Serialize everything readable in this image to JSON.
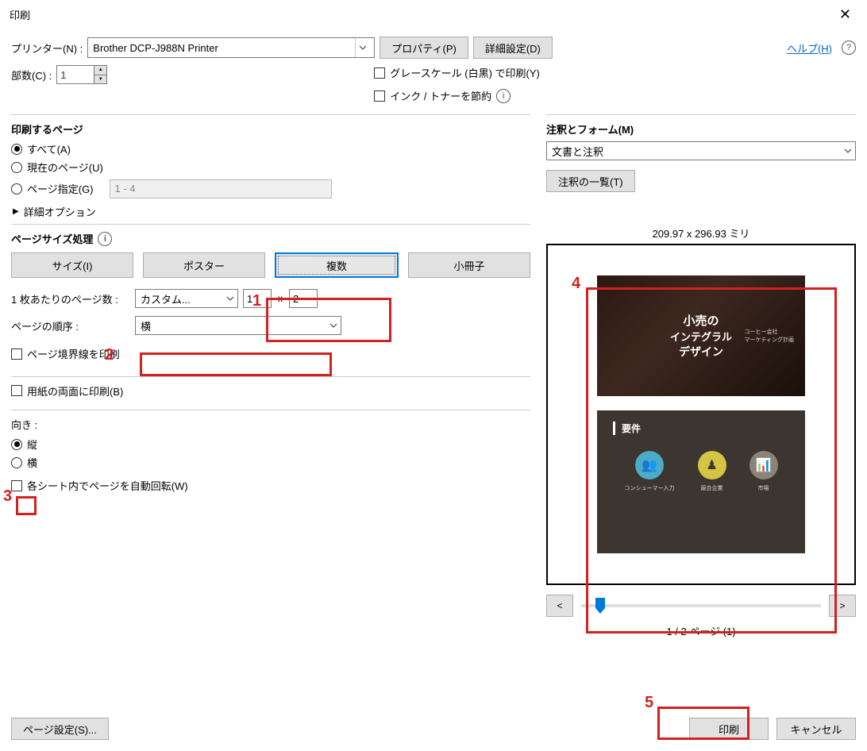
{
  "window": {
    "title": "印刷"
  },
  "help": {
    "text": "ヘルプ(H)"
  },
  "printer": {
    "label": "プリンター(N) :",
    "value": "Brother DCP-J988N Printer",
    "properties_button": "プロパティ(P)",
    "advanced_button": "詳細設定(D)"
  },
  "copies": {
    "label": "部数(C) :",
    "value": "1"
  },
  "options": {
    "grayscale": "グレースケール (白黒) で印刷(Y)",
    "save_ink": "インク / トナーを節約"
  },
  "pages": {
    "section": "印刷するページ",
    "all": "すべて(A)",
    "current": "現在のページ(U)",
    "range_label": "ページ指定(G)",
    "range_value": "1 - 4",
    "advanced": "詳細オプション"
  },
  "size": {
    "section": "ページサイズ処理",
    "tabs": {
      "size": "サイズ(I)",
      "poster": "ポスター",
      "multiple": "複数",
      "booklet": "小冊子"
    },
    "pages_per_sheet_label": "1 枚あたりのページ数 :",
    "pages_per_sheet_value": "カスタム...",
    "custom_w": "1",
    "custom_x": "x",
    "custom_h": "2",
    "order_label": "ページの順序 :",
    "order_value": "横",
    "border": "ページ境界線を印刷"
  },
  "duplex": {
    "label": "用紙の両面に印刷(B)"
  },
  "orientation": {
    "label": "向き :",
    "portrait": "縦",
    "landscape": "横",
    "auto_rotate": "各シート内でページを自動回転(W)"
  },
  "annotations": {
    "section": "注釈とフォーム(M)",
    "value": "文書と注釈",
    "list_button": "注釈の一覧(T)"
  },
  "preview": {
    "dimensions": "209.97 x 296.93 ミリ",
    "slide1_line1": "小売の",
    "slide1_line2": "インテグラル",
    "slide1_line3": "デザイン",
    "slide1_sub1": "コーヒー会社",
    "slide1_sub2": "マーケティング計画",
    "slide2_header": "要件",
    "slide2_item1": "コンシューマー入力",
    "slide2_item2": "競合企業",
    "slide2_item3": "市場",
    "prev": "<",
    "next": ">",
    "page_indicator": "1 / 2 ページ (1)"
  },
  "bottom": {
    "page_setup": "ページ設定(S)...",
    "print": "印刷",
    "cancel": "キャンセル"
  },
  "callouts": {
    "n1": "1",
    "n2": "2",
    "n3": "3",
    "n4": "4",
    "n5": "5"
  }
}
